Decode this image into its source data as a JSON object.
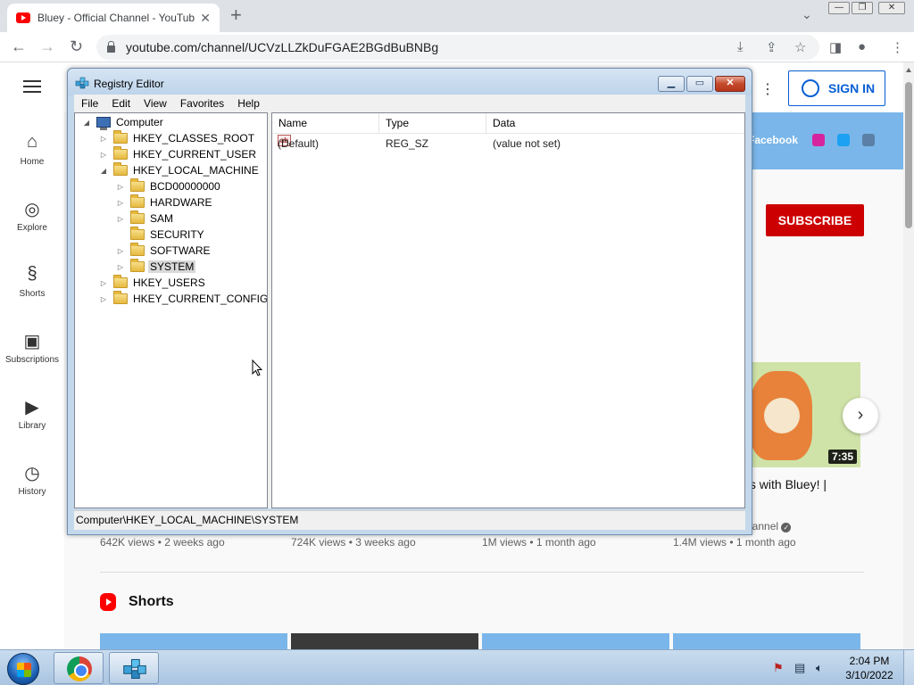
{
  "browser": {
    "tab_title": "Bluey - Official Channel - YouTube",
    "tab_close": "✕",
    "new_tab": "+",
    "tab_menu": "⌄",
    "url": "youtube.com/channel/UCVzLLZkDuFGAE2BGdBuBNBg",
    "back": "←",
    "forward": "→",
    "reload": "↻",
    "toolbar_icons": [
      "download-icon",
      "share-icon",
      "star-icon",
      "sidepanel-icon",
      "profile-icon",
      "menu-icon"
    ]
  },
  "youtube": {
    "sidebar": [
      {
        "label": "Home",
        "icon": "home-icon",
        "glyph": "⌂"
      },
      {
        "label": "Explore",
        "icon": "compass-icon",
        "glyph": "◎"
      },
      {
        "label": "Shorts",
        "icon": "shorts-icon",
        "glyph": "§"
      },
      {
        "label": "Subscriptions",
        "icon": "subscriptions-icon",
        "glyph": "▣"
      },
      {
        "label": "Library",
        "icon": "library-icon",
        "glyph": "▶"
      },
      {
        "label": "History",
        "icon": "history-icon",
        "glyph": "◷"
      }
    ],
    "sign_in": "SIGN IN",
    "banner_link": "Facebook",
    "subscribe": "SUBSCRIBE",
    "video_duration": "7:35",
    "video_title_partial": "ts with Bluey! |",
    "video_channel_partial": "hannel",
    "views": [
      "642K views • 2 weeks ago",
      "724K views • 3 weeks ago",
      "1M views • 1 month ago",
      "1.4M views • 1 month ago"
    ],
    "shorts_heading": "Shorts",
    "next_arrow": "›"
  },
  "registry_editor": {
    "title": "Registry Editor",
    "menu": [
      "File",
      "Edit",
      "View",
      "Favorites",
      "Help"
    ],
    "window_buttons": {
      "minimize": "▁",
      "maximize": "▭",
      "close": "✕"
    },
    "tree": [
      {
        "label": "Computer",
        "level": 0,
        "expander": "◢",
        "icon": "computer-icon"
      },
      {
        "label": "HKEY_CLASSES_ROOT",
        "level": 1,
        "expander": "▷"
      },
      {
        "label": "HKEY_CURRENT_USER",
        "level": 1,
        "expander": "▷"
      },
      {
        "label": "HKEY_LOCAL_MACHINE",
        "level": 1,
        "expander": "◢"
      },
      {
        "label": "BCD00000000",
        "level": 2,
        "expander": "▷"
      },
      {
        "label": "HARDWARE",
        "level": 2,
        "expander": "▷"
      },
      {
        "label": "SAM",
        "level": 2,
        "expander": "▷"
      },
      {
        "label": "SECURITY",
        "level": 2,
        "expander": ""
      },
      {
        "label": "SOFTWARE",
        "level": 2,
        "expander": "▷"
      },
      {
        "label": "SYSTEM",
        "level": 2,
        "expander": "▷",
        "selected": true
      },
      {
        "label": "HKEY_USERS",
        "level": 1,
        "expander": "▷"
      },
      {
        "label": "HKEY_CURRENT_CONFIG",
        "level": 1,
        "expander": "▷"
      }
    ],
    "columns": [
      "Name",
      "Type",
      "Data"
    ],
    "rows": [
      {
        "name": "(Default)",
        "type": "REG_SZ",
        "data": "(value not set)",
        "icon": "ab"
      }
    ],
    "status": "Computer\\HKEY_LOCAL_MACHINE\\SYSTEM"
  },
  "taskbar": {
    "time": "2:04 PM",
    "date": "3/10/2022",
    "tray_icons": [
      "action-center-icon",
      "network-icon",
      "volume-icon"
    ]
  }
}
